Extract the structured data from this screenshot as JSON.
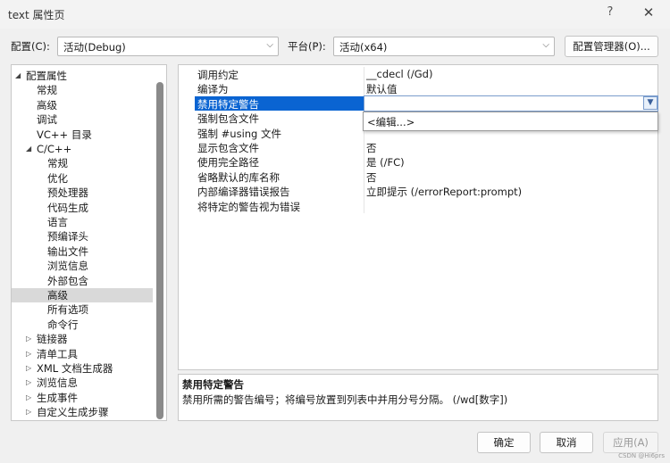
{
  "window": {
    "title": "text 属性页",
    "help": "?",
    "close": "✕"
  },
  "config": {
    "label": "配置(C):",
    "value": "活动(Debug)"
  },
  "platform": {
    "label": "平台(P):",
    "value": "活动(x64)"
  },
  "config_manager_label": "配置管理器(O)...",
  "tree": {
    "items": [
      {
        "label": "配置属性",
        "expander": "◢"
      },
      {
        "label": "常规"
      },
      {
        "label": "高级"
      },
      {
        "label": "调试"
      },
      {
        "label": "VC++ 目录"
      },
      {
        "label": "C/C++",
        "expander": "◢"
      },
      {
        "label": "常规"
      },
      {
        "label": "优化"
      },
      {
        "label": "预处理器"
      },
      {
        "label": "代码生成"
      },
      {
        "label": "语言"
      },
      {
        "label": "预编译头"
      },
      {
        "label": "输出文件"
      },
      {
        "label": "浏览信息"
      },
      {
        "label": "外部包含"
      },
      {
        "label": "高级"
      },
      {
        "label": "所有选项"
      },
      {
        "label": "命令行"
      },
      {
        "label": "链接器",
        "expander": "▷"
      },
      {
        "label": "清单工具",
        "expander": "▷"
      },
      {
        "label": "XML 文档生成器",
        "expander": "▷"
      },
      {
        "label": "浏览信息",
        "expander": "▷"
      },
      {
        "label": "生成事件",
        "expander": "▷"
      },
      {
        "label": "自定义生成步骤",
        "expander": "▷"
      }
    ]
  },
  "properties": [
    {
      "name": "调用约定",
      "value": "__cdecl (/Gd)"
    },
    {
      "name": "编译为",
      "value": "默认值"
    },
    {
      "name": "禁用特定警告",
      "value": ""
    },
    {
      "name": "强制包含文件",
      "value": ""
    },
    {
      "name": "强制 #using 文件",
      "value": ""
    },
    {
      "name": "显示包含文件",
      "value": "否"
    },
    {
      "name": "使用完全路径",
      "value": "是 (/FC)"
    },
    {
      "name": "省略默认的库名称",
      "value": "否"
    },
    {
      "name": "内部编译器错误报告",
      "value": "立即提示 (/errorReport:prompt)"
    },
    {
      "name": "将特定的警告视为错误",
      "value": ""
    }
  ],
  "dropdown": {
    "option": "<编辑...>"
  },
  "description": {
    "title": "禁用特定警告",
    "text": "禁用所需的警告编号；将编号放置到列表中并用分号分隔。     (/wd[数字])"
  },
  "buttons": {
    "ok": "确定",
    "cancel": "取消",
    "apply": "应用(A)"
  },
  "watermark": "CSDN @Hi6prs"
}
